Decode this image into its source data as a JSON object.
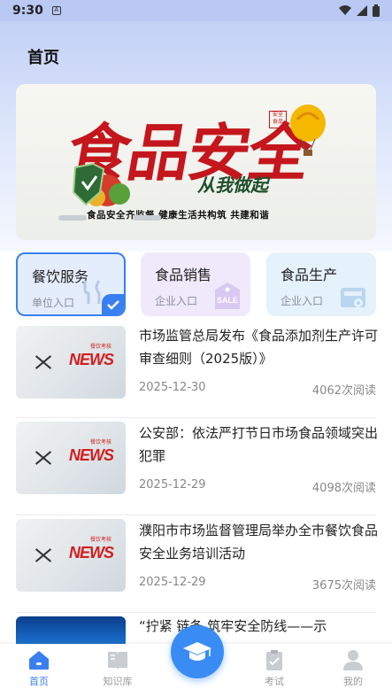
{
  "status_bar": {
    "time": "9:30"
  },
  "header": {
    "title": "首页"
  },
  "banner": {
    "title": "食品安全",
    "subtitle": "从我做起",
    "caption": "食品安全齐监督 健康生活共构筑 共建和谐",
    "seal": "安全 食品"
  },
  "categories": [
    {
      "title": "餐饮服务",
      "subtitle": "单位入口",
      "icon": "cutlery-icon",
      "selected": true
    },
    {
      "title": "食品销售",
      "subtitle": "企业入口",
      "icon": "sale-tag-icon",
      "badge": "SALE"
    },
    {
      "title": "食品生产",
      "subtitle": "企业入口",
      "icon": "machine-icon"
    }
  ],
  "news": [
    {
      "title": "市场监管总局发布《食品添加剂生产许可审查细则（2025版）》",
      "date": "2025-12-30",
      "reads": "4062次阅读",
      "thumb_word": "NEWS",
      "thumb_tag": "餐饮考核"
    },
    {
      "title": "公安部：依法严打节日市场食品领域突出犯罪",
      "date": "2025-12-29",
      "reads": "4098次阅读",
      "thumb_word": "NEWS",
      "thumb_tag": "餐饮考核"
    },
    {
      "title": "濮阳市市场监督管理局举办全市餐饮食品安全业务培训活动",
      "date": "2025-12-29",
      "reads": "3675次阅读",
      "thumb_word": "NEWS",
      "thumb_tag": "餐饮考核"
    },
    {
      "title": "“拧紧 链条 筑牢安全防线——示"
    }
  ],
  "tabs": [
    {
      "label": "首页",
      "icon": "home-icon",
      "active": true
    },
    {
      "label": "知识库",
      "icon": "book-icon"
    },
    {
      "label": "考试",
      "icon": "clipboard-icon"
    },
    {
      "label": "我的",
      "icon": "user-icon"
    }
  ],
  "fab": {
    "icon": "graduation-cap-icon"
  },
  "colors": {
    "accent": "#3a7ff0",
    "banner_red": "#c4161c"
  }
}
